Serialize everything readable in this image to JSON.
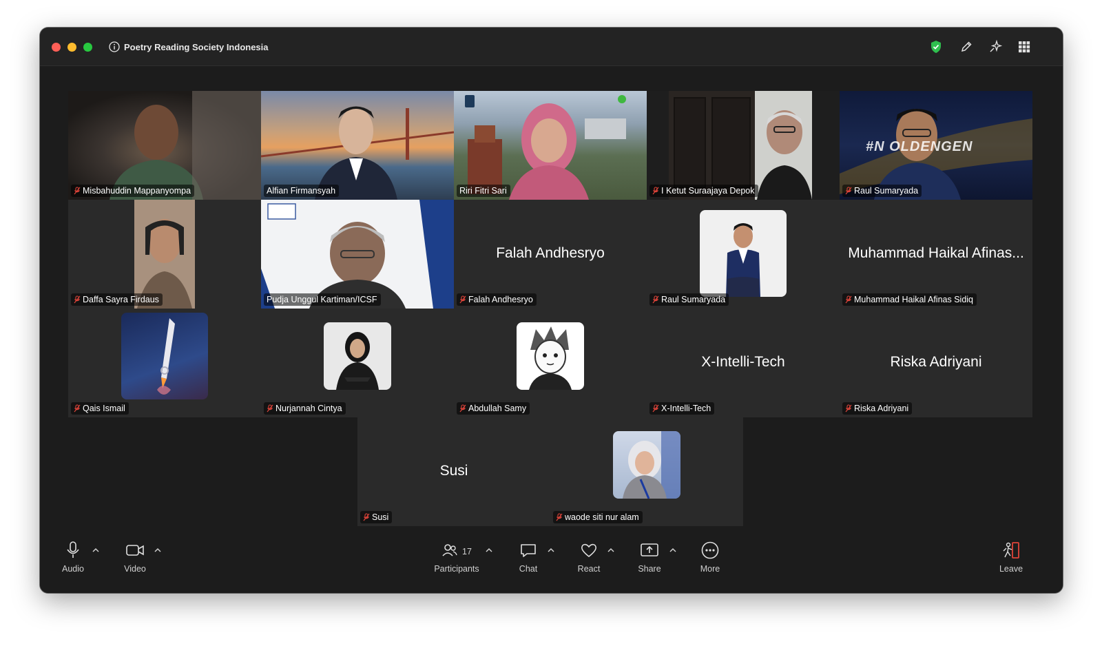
{
  "window": {
    "title": "Poetry Reading Society Indonesia"
  },
  "titlebar_icons": [
    "shield-check-icon",
    "pencil-icon",
    "sparkle-icon",
    "grid-icon"
  ],
  "colors": {
    "speaker_border": "#3fd24b",
    "muted_red": "#e0443a",
    "tile_bg": "#2a2a2a",
    "window_bg": "#1c1c1c"
  },
  "participants": [
    {
      "name": "Misbahuddin Mappanyompa",
      "muted": true,
      "kind": "video"
    },
    {
      "name": "Alfian Firmansyah",
      "muted": false,
      "kind": "video"
    },
    {
      "name": "Riri Fitri Sari",
      "muted": false,
      "kind": "video",
      "active_speaker": true
    },
    {
      "name": "I Ketut Suraajaya Depok",
      "muted": true,
      "kind": "video"
    },
    {
      "name": "Raul Sumaryada",
      "muted": true,
      "kind": "video",
      "overlay_text": "#N OLDENGEN"
    },
    {
      "name": "Daffa Sayra Firdaus",
      "muted": true,
      "kind": "video"
    },
    {
      "name": "Pudja Unggul Kartiman/ICSF",
      "muted": false,
      "kind": "video"
    },
    {
      "name": "Falah Andhesryo",
      "display": "Falah Andhesryo",
      "muted": true,
      "kind": "name"
    },
    {
      "name": "Raul Sumaryada",
      "muted": true,
      "kind": "avatar"
    },
    {
      "name": "Muhammad Haikal Afinas Sidiq",
      "display": "Muhammad Haikal Afinas...",
      "muted": true,
      "kind": "name"
    },
    {
      "name": "Qais Ismail",
      "muted": true,
      "kind": "avatar"
    },
    {
      "name": "Nurjannah Cintya",
      "muted": true,
      "kind": "avatar"
    },
    {
      "name": "Abdullah Samy",
      "muted": true,
      "kind": "avatar"
    },
    {
      "name": "X-Intelli-Tech",
      "display": "X-Intelli-Tech",
      "muted": true,
      "kind": "name"
    },
    {
      "name": "Riska Adriyani",
      "display": "Riska Adriyani",
      "muted": true,
      "kind": "name"
    },
    {
      "name": "Susi",
      "display": "Susi",
      "muted": true,
      "kind": "name"
    },
    {
      "name": "waode siti nur alam",
      "muted": true,
      "kind": "avatar"
    }
  ],
  "toolbar": {
    "audio": "Audio",
    "video": "Video",
    "participants": "Participants",
    "participants_count": "17",
    "chat": "Chat",
    "react": "React",
    "share": "Share",
    "more": "More",
    "leave": "Leave"
  }
}
